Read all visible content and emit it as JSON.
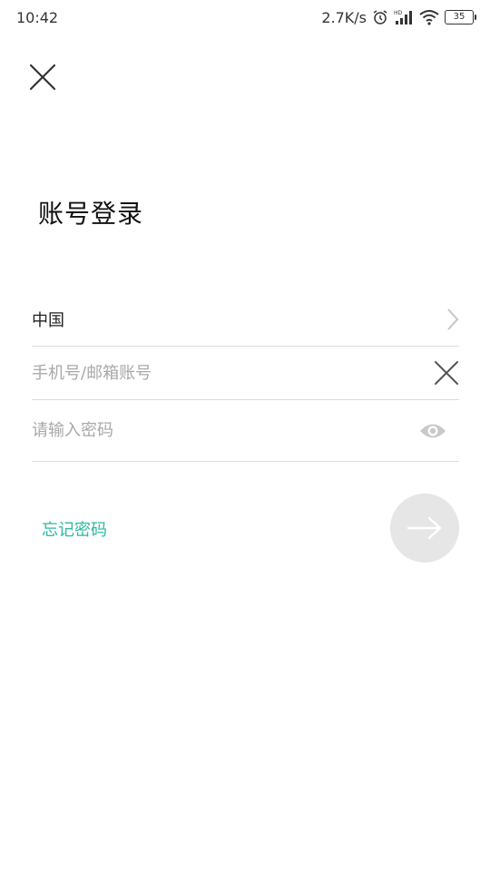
{
  "status": {
    "time": "10:42",
    "net_speed": "2.7K/s",
    "signal_tag": "HD",
    "battery": "35"
  },
  "header": {
    "close_icon": "close-icon"
  },
  "main": {
    "title": "账号登录",
    "country": "中国",
    "phone_placeholder": "手机号/邮箱账号",
    "password_placeholder": "请输入密码",
    "forgot_label": "忘记密码"
  },
  "colors": {
    "accent": "#2bb8a3",
    "submit_bg": "#e6e6e6",
    "divider": "#dcdcdc"
  },
  "icons": [
    "close-icon",
    "chevron-right-icon",
    "clear-icon",
    "eye-icon",
    "arrow-right-icon",
    "alarm-icon",
    "signal-icon",
    "wifi-icon",
    "battery-icon"
  ]
}
